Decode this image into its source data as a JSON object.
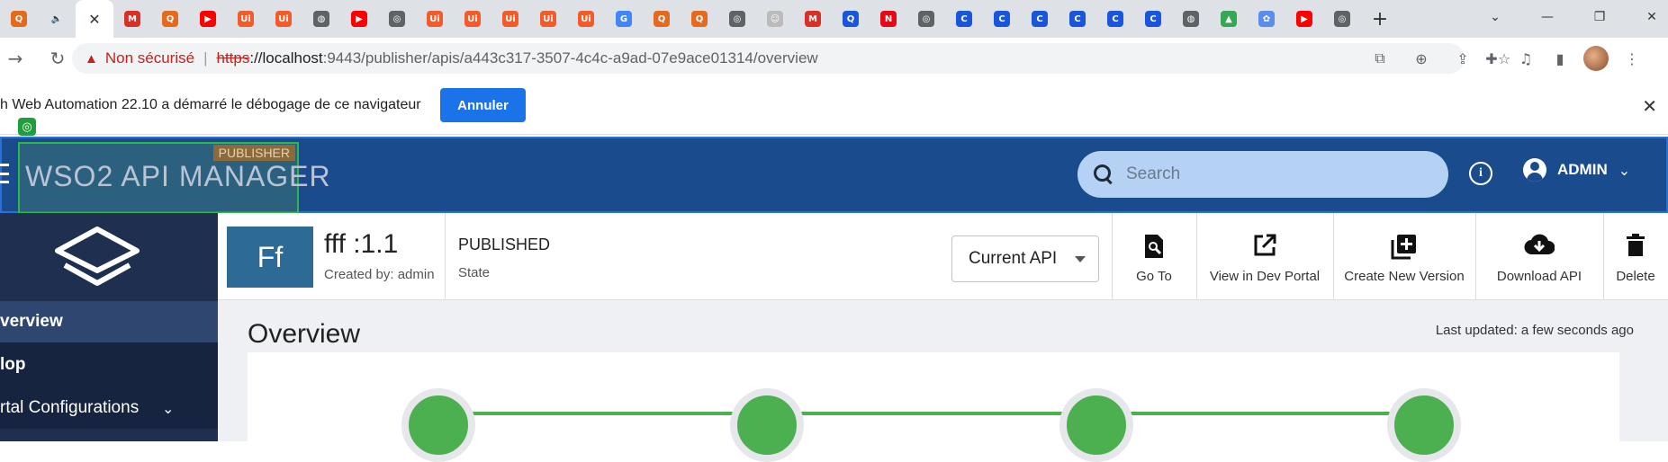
{
  "browser": {
    "tabs": [
      {
        "icon": "wso2-favicon-icon",
        "color": "#e66a1e",
        "glyph": "Q"
      },
      {
        "icon": "speaker-icon",
        "color": "#dee1e6",
        "glyph": "🔈",
        "active": false
      },
      {
        "icon": "close-tab-icon",
        "glyph": "✕",
        "active": true
      },
      {
        "icon": "gmail-icon",
        "color": "#d93025",
        "glyph": "M"
      },
      {
        "icon": "wso2-favicon-icon",
        "color": "#e66a1e",
        "glyph": "Q"
      },
      {
        "icon": "youtube-icon",
        "color": "#ff0000",
        "glyph": "▶"
      },
      {
        "icon": "uipath-icon",
        "color": "#f25c2a",
        "glyph": "Ui"
      },
      {
        "icon": "uipath-icon",
        "color": "#f25c2a",
        "glyph": "Ui"
      },
      {
        "icon": "globe-icon",
        "color": "#5f6368",
        "glyph": "◍"
      },
      {
        "icon": "youtube-icon",
        "color": "#ff0000",
        "glyph": "▶"
      },
      {
        "icon": "chrome-icon",
        "color": "#5f6368",
        "glyph": "◎"
      },
      {
        "icon": "uipath-icon",
        "color": "#f25c2a",
        "glyph": "Ui"
      },
      {
        "icon": "uipath-icon",
        "color": "#f25c2a",
        "glyph": "Ui"
      },
      {
        "icon": "uipath-icon",
        "color": "#f25c2a",
        "glyph": "Ui"
      },
      {
        "icon": "uipath-icon",
        "color": "#f25c2a",
        "glyph": "Ui"
      },
      {
        "icon": "uipath-icon",
        "color": "#f25c2a",
        "glyph": "Ui"
      },
      {
        "icon": "google-icon",
        "color": "#4285f4",
        "glyph": "G"
      },
      {
        "icon": "wso2-favicon-icon",
        "color": "#e66a1e",
        "glyph": "Q"
      },
      {
        "icon": "wso2-favicon-icon",
        "color": "#e66a1e",
        "glyph": "Q"
      },
      {
        "icon": "chrome-icon",
        "color": "#5f6368",
        "glyph": "◎"
      },
      {
        "icon": "ghost-icon",
        "color": "#bbbbbb",
        "glyph": "☺"
      },
      {
        "icon": "gmail-icon",
        "color": "#d93025",
        "glyph": "M"
      },
      {
        "icon": "q-icon",
        "color": "#1a56db",
        "glyph": "Q"
      },
      {
        "icon": "netflix-icon",
        "color": "#e50914",
        "glyph": "N"
      },
      {
        "icon": "chrome-icon",
        "color": "#5f6368",
        "glyph": "◎"
      },
      {
        "icon": "c-blue-icon",
        "color": "#1a56db",
        "glyph": "C"
      },
      {
        "icon": "c-blue-icon",
        "color": "#1a56db",
        "glyph": "C"
      },
      {
        "icon": "c-blue-icon",
        "color": "#1a56db",
        "glyph": "C"
      },
      {
        "icon": "c-blue-icon",
        "color": "#1a56db",
        "glyph": "C"
      },
      {
        "icon": "c-blue-icon",
        "color": "#1a56db",
        "glyph": "C"
      },
      {
        "icon": "c-blue-icon",
        "color": "#1a56db",
        "glyph": "C"
      },
      {
        "icon": "globe-icon",
        "color": "#5f6368",
        "glyph": "◍"
      },
      {
        "icon": "google-drive-icon",
        "color": "#34a853",
        "glyph": "▲"
      },
      {
        "icon": "gift-icon",
        "color": "#5b8def",
        "glyph": "✿"
      },
      {
        "icon": "youtube-icon",
        "color": "#ff0000",
        "glyph": "▶"
      },
      {
        "icon": "chrome-icon",
        "color": "#5f6368",
        "glyph": "◎"
      }
    ],
    "omnibox": {
      "warning": "Non sécurisé",
      "separator": "|",
      "scheme": "https",
      "host_rest": "://localhost",
      "path": ":9443/publisher/apis/a443c317-3507-4c4c-a9ad-07e9ace01314/overview"
    },
    "infobar": {
      "message": "h Web Automation 22.10 a démarré le débogage de ce navigateur",
      "cancel_label": "Annuler"
    }
  },
  "app": {
    "logo_text": "WSO2 API MANAGER",
    "badge": "PUBLISHER",
    "search_placeholder": "Search",
    "user_name": "ADMIN",
    "brand_color": "#1a4b8c"
  },
  "nav": {
    "items": [
      {
        "label": "verview",
        "selected": true
      },
      {
        "label": "lop",
        "dark": true
      },
      {
        "label": "rtal Configurations",
        "dark": true
      }
    ]
  },
  "api": {
    "thumb": "Ff",
    "name": "fff :1.1",
    "created_by": "Created by: admin",
    "state": "PUBLISHED",
    "state_label": "State",
    "version_select": "Current API",
    "actions": [
      {
        "label": "Go To"
      },
      {
        "label": "View in Dev Portal"
      },
      {
        "label": "Create New Version"
      },
      {
        "label": "Download API"
      },
      {
        "label": "Delete"
      }
    ]
  },
  "overview": {
    "title": "Overview",
    "last_updated": "Last updated: a few seconds ago",
    "lifecycle_nodes": 4,
    "accent_color": "#4caf50"
  }
}
